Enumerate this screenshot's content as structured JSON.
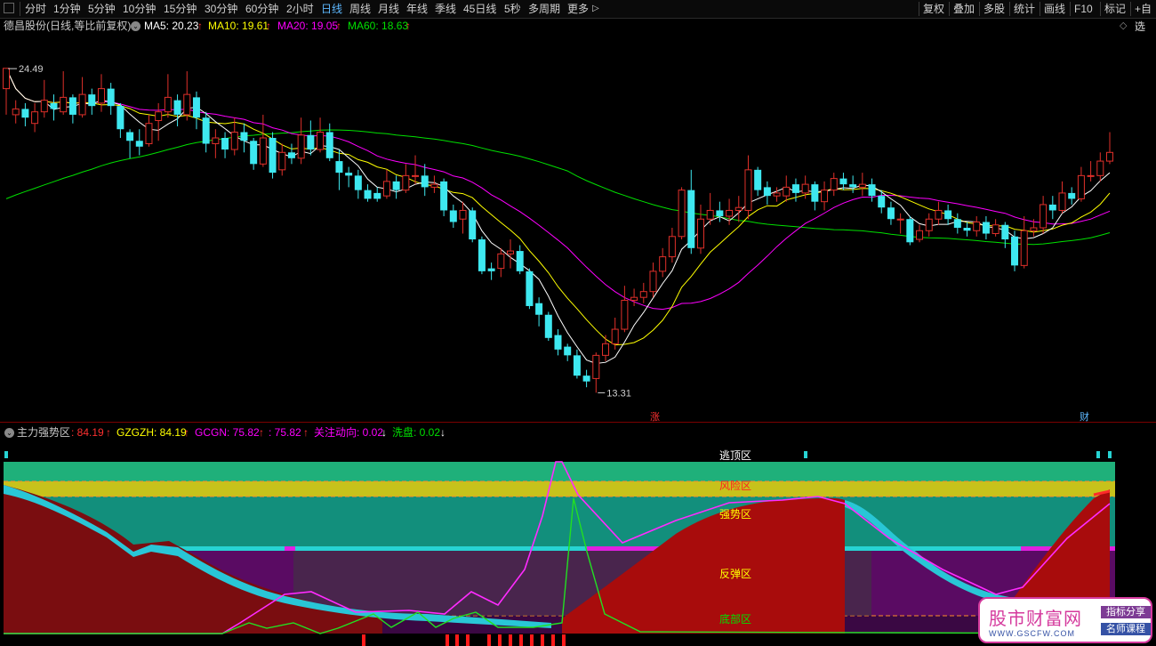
{
  "toolbar": {
    "periods": [
      "分时",
      "1分钟",
      "5分钟",
      "10分钟",
      "15分钟",
      "30分钟",
      "60分钟",
      "2小时",
      "日线",
      "周线",
      "月线",
      "年线",
      "季线",
      "45日线",
      "5秒",
      "多周期",
      "更多"
    ],
    "active_period": "日线",
    "more_arrow": "▷",
    "right_buttons": [
      "复权",
      "叠加",
      "多股",
      "统计",
      "画线",
      "F10",
      "标记",
      "+自选"
    ]
  },
  "main_legend": {
    "stock": "德昌股份(日线,等比前复权)",
    "ma5": "MA5: 20.23",
    "ma10": "MA10: 19.61",
    "ma20": "MA20: 19.05",
    "ma60": "MA60: 18.63",
    "up_arrow": "↑",
    "colors": {
      "ma5": "#ffffff",
      "ma10": "#ffff00",
      "ma20": "#ff00ff",
      "ma60": "#00e000"
    }
  },
  "main_chart": {
    "high_label": "24.49",
    "low_label": "13.31",
    "marker_zhang": "涨",
    "marker_cai": "财",
    "diamond_icon": "◇",
    "window_icon": "▢"
  },
  "sub_legend": {
    "title": "主力强势区",
    "v1": ": 84.19",
    "gzgzh": "GZGZH: 84.19",
    "gcgn": "GCGN: 75.82",
    "v2": ": 75.82",
    "gzdx": "关注动向: 0.02",
    "xp": "洗盘: 0.02",
    "down_arrow": "↓",
    "up_arrow": "↑"
  },
  "zones": {
    "jinding": "逃顶区",
    "fengxian": "风险区",
    "qiangshi": "强势区",
    "fantan": "反弹区",
    "dibu": "底部区"
  },
  "watermark": {
    "name": "股市财富网",
    "tag1": "指标分享",
    "tag2": "名师课程",
    "url": "WWW.GSCFW.COM"
  },
  "chart_data": {
    "type": "candlestick",
    "title": "德昌股份(日线,等比前复权)",
    "ylim": [
      12.8,
      25.2
    ],
    "max_price": 24.49,
    "min_price": 13.31,
    "moving_averages": [
      {
        "name": "MA5",
        "last": 20.23
      },
      {
        "name": "MA10",
        "last": 19.61
      },
      {
        "name": "MA20",
        "last": 19.05
      },
      {
        "name": "MA60",
        "last": 18.63
      }
    ],
    "candles": [
      [
        23.8,
        24.5,
        24.5,
        22.9
      ],
      [
        22.9,
        23.1,
        23.4,
        22.6
      ],
      [
        23.1,
        22.8,
        23.3,
        22.5
      ],
      [
        22.6,
        23.0,
        23.3,
        22.3
      ],
      [
        23.0,
        23.4,
        24.1,
        22.8
      ],
      [
        23.3,
        23.1,
        23.6,
        22.7
      ],
      [
        23.0,
        23.5,
        24.4,
        22.9
      ],
      [
        23.5,
        22.9,
        23.6,
        22.6
      ],
      [
        22.9,
        23.6,
        24.2,
        22.8
      ],
      [
        23.6,
        23.2,
        23.8,
        22.9
      ],
      [
        23.3,
        23.8,
        24.3,
        23.0
      ],
      [
        23.8,
        23.2,
        24.0,
        22.9
      ],
      [
        23.2,
        22.4,
        23.3,
        22.1
      ],
      [
        22.3,
        22.0,
        22.4,
        21.4
      ],
      [
        22.0,
        21.8,
        22.4,
        21.5
      ],
      [
        21.9,
        22.6,
        22.9,
        21.8
      ],
      [
        22.7,
        23.0,
        23.3,
        22.0
      ],
      [
        23.0,
        23.5,
        24.3,
        22.8
      ],
      [
        23.4,
        22.9,
        23.6,
        22.5
      ],
      [
        22.9,
        23.6,
        24.4,
        22.7
      ],
      [
        23.5,
        22.8,
        23.7,
        22.4
      ],
      [
        22.8,
        21.9,
        23.0,
        21.6
      ],
      [
        21.9,
        22.1,
        22.4,
        21.4
      ],
      [
        22.1,
        21.7,
        22.3,
        21.4
      ],
      [
        21.7,
        22.3,
        22.8,
        21.5
      ],
      [
        22.3,
        22.0,
        22.6,
        21.6
      ],
      [
        22.0,
        21.2,
        22.1,
        21.0
      ],
      [
        21.2,
        22.1,
        22.9,
        21.1
      ],
      [
        22.1,
        20.9,
        22.3,
        20.7
      ],
      [
        21.0,
        21.6,
        21.9,
        20.8
      ],
      [
        21.6,
        21.4,
        21.9,
        21.2
      ],
      [
        21.4,
        22.2,
        22.8,
        21.2
      ],
      [
        22.2,
        21.7,
        22.7,
        21.5
      ],
      [
        21.7,
        22.3,
        22.8,
        21.6
      ],
      [
        22.3,
        21.4,
        22.6,
        21.3
      ],
      [
        21.3,
        20.9,
        21.7,
        20.3
      ],
      [
        20.9,
        20.8,
        21.1,
        20.4
      ],
      [
        20.8,
        20.3,
        21.0,
        20.0
      ],
      [
        20.3,
        20.0,
        20.5,
        19.9
      ],
      [
        20.2,
        20.0,
        20.4,
        19.9
      ],
      [
        20.1,
        20.6,
        21.0,
        20.0
      ],
      [
        20.6,
        20.3,
        20.8,
        20.0
      ],
      [
        20.3,
        20.8,
        21.2,
        20.2
      ],
      [
        20.8,
        20.8,
        21.5,
        20.5
      ],
      [
        20.8,
        20.4,
        21.2,
        20.1
      ],
      [
        20.4,
        20.5,
        20.8,
        20.2
      ],
      [
        20.6,
        19.6,
        20.7,
        19.4
      ],
      [
        19.6,
        19.2,
        19.8,
        19.0
      ],
      [
        19.3,
        19.6,
        19.9,
        18.8
      ],
      [
        19.6,
        18.6,
        19.7,
        18.5
      ],
      [
        18.6,
        17.5,
        18.7,
        17.4
      ],
      [
        17.6,
        17.5,
        17.8,
        17.2
      ],
      [
        17.6,
        18.1,
        18.3,
        17.3
      ],
      [
        18.1,
        18.2,
        18.6,
        17.6
      ],
      [
        18.2,
        17.5,
        18.4,
        17.4
      ],
      [
        17.5,
        16.3,
        17.6,
        16.2
      ],
      [
        16.4,
        16.0,
        16.6,
        15.6
      ],
      [
        16.0,
        15.2,
        16.1,
        15.1
      ],
      [
        15.3,
        14.8,
        15.5,
        14.6
      ],
      [
        14.9,
        14.6,
        15.0,
        14.4
      ],
      [
        14.6,
        13.9,
        14.8,
        13.8
      ],
      [
        13.9,
        13.7,
        14.1,
        13.5
      ],
      [
        13.8,
        14.6,
        14.7,
        13.31
      ],
      [
        14.6,
        15.0,
        15.3,
        14.4
      ],
      [
        15.0,
        15.5,
        15.9,
        14.8
      ],
      [
        15.5,
        16.5,
        17.0,
        15.4
      ],
      [
        16.5,
        16.6,
        16.9,
        16.3
      ],
      [
        16.6,
        16.8,
        17.1,
        16.4
      ],
      [
        16.8,
        17.5,
        17.8,
        16.6
      ],
      [
        17.5,
        18.0,
        18.3,
        17.3
      ],
      [
        18.0,
        18.7,
        19.0,
        17.8
      ],
      [
        18.7,
        20.3,
        20.4,
        18.6
      ],
      [
        20.3,
        18.3,
        21.0,
        18.1
      ],
      [
        18.3,
        19.3,
        19.8,
        18.1
      ],
      [
        19.3,
        19.6,
        20.2,
        19.1
      ],
      [
        19.6,
        19.4,
        19.9,
        19.2
      ],
      [
        19.4,
        19.6,
        20.0,
        19.1
      ],
      [
        19.6,
        19.7,
        20.1,
        19.2
      ],
      [
        19.6,
        21.0,
        21.5,
        19.3
      ],
      [
        21.0,
        20.3,
        21.1,
        20.1
      ],
      [
        20.4,
        20.1,
        20.6,
        19.8
      ],
      [
        20.1,
        20.2,
        20.4,
        19.9
      ],
      [
        20.1,
        20.4,
        20.8,
        19.9
      ],
      [
        20.5,
        20.2,
        20.7,
        19.9
      ],
      [
        20.2,
        20.5,
        20.8,
        20.0
      ],
      [
        20.5,
        19.9,
        20.6,
        19.6
      ],
      [
        19.9,
        20.3,
        20.6,
        19.6
      ],
      [
        20.3,
        20.7,
        20.9,
        20.1
      ],
      [
        20.7,
        20.5,
        20.9,
        20.3
      ],
      [
        20.5,
        20.4,
        20.8,
        20.2
      ],
      [
        20.4,
        20.5,
        20.9,
        20.1
      ],
      [
        20.5,
        20.1,
        20.7,
        19.9
      ],
      [
        20.1,
        19.7,
        20.3,
        19.5
      ],
      [
        19.7,
        19.3,
        19.9,
        19.1
      ],
      [
        19.3,
        19.3,
        19.5,
        18.8
      ],
      [
        19.3,
        18.5,
        19.4,
        18.4
      ],
      [
        18.6,
        18.9,
        19.1,
        18.5
      ],
      [
        18.9,
        19.3,
        19.5,
        18.7
      ],
      [
        19.3,
        19.6,
        19.9,
        19.1
      ],
      [
        19.6,
        19.3,
        19.8,
        19.1
      ],
      [
        19.3,
        19.0,
        19.5,
        18.8
      ],
      [
        19.0,
        18.9,
        19.2,
        18.7
      ],
      [
        18.9,
        19.2,
        19.4,
        18.7
      ],
      [
        19.2,
        18.8,
        19.4,
        18.6
      ],
      [
        18.8,
        19.1,
        19.3,
        18.7
      ],
      [
        19.1,
        18.6,
        19.2,
        18.3
      ],
      [
        18.7,
        17.7,
        18.9,
        17.5
      ],
      [
        17.7,
        18.9,
        19.4,
        17.6
      ],
      [
        18.9,
        19.0,
        19.3,
        18.7
      ],
      [
        19.0,
        19.8,
        20.1,
        18.8
      ],
      [
        19.8,
        19.6,
        20.1,
        19.3
      ],
      [
        19.6,
        20.2,
        20.6,
        19.5
      ],
      [
        20.2,
        20.0,
        20.4,
        19.8
      ],
      [
        20.0,
        20.8,
        21.1,
        19.9
      ],
      [
        20.8,
        20.8,
        21.3,
        20.6
      ],
      [
        20.8,
        21.3,
        21.6,
        20.6
      ],
      [
        21.3,
        21.6,
        22.3,
        21.2
      ]
    ]
  }
}
